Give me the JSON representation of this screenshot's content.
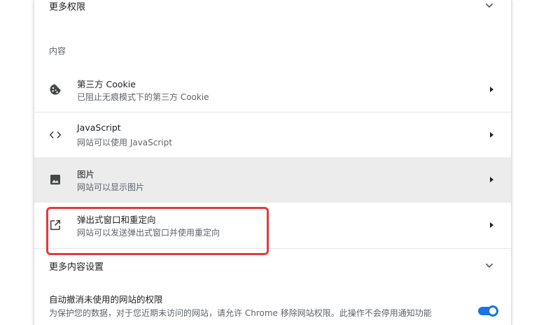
{
  "more_permissions": {
    "label": "更多权限"
  },
  "content_section": {
    "title": "内容"
  },
  "content_rows": [
    {
      "title": "第三方 Cookie",
      "subtitle": "已阻止无痕模式下的第三方 Cookie",
      "icon": "cookie-icon"
    },
    {
      "title": "JavaScript",
      "subtitle": "网站可以使用 JavaScript",
      "icon": "code-icon"
    },
    {
      "title": "图片",
      "subtitle": "网站可以显示图片",
      "icon": "image-icon"
    },
    {
      "title": "弹出式窗口和重定向",
      "subtitle": "网站可以发送弹出式窗口并使用重定向",
      "icon": "open-in-new-icon"
    }
  ],
  "more_content_settings": {
    "label": "更多内容设置"
  },
  "auto_revoke": {
    "title": "自动撤消未使用的网站的权限",
    "description": "为保护您的数据，对于您近期未访问的网站，请允许 Chrome 移除网站权限。此操作不会停用通知功能",
    "enabled": true
  },
  "colors": {
    "accent": "#1a73e8",
    "highlight": "#e5393b",
    "hover_row": "#ececec"
  }
}
